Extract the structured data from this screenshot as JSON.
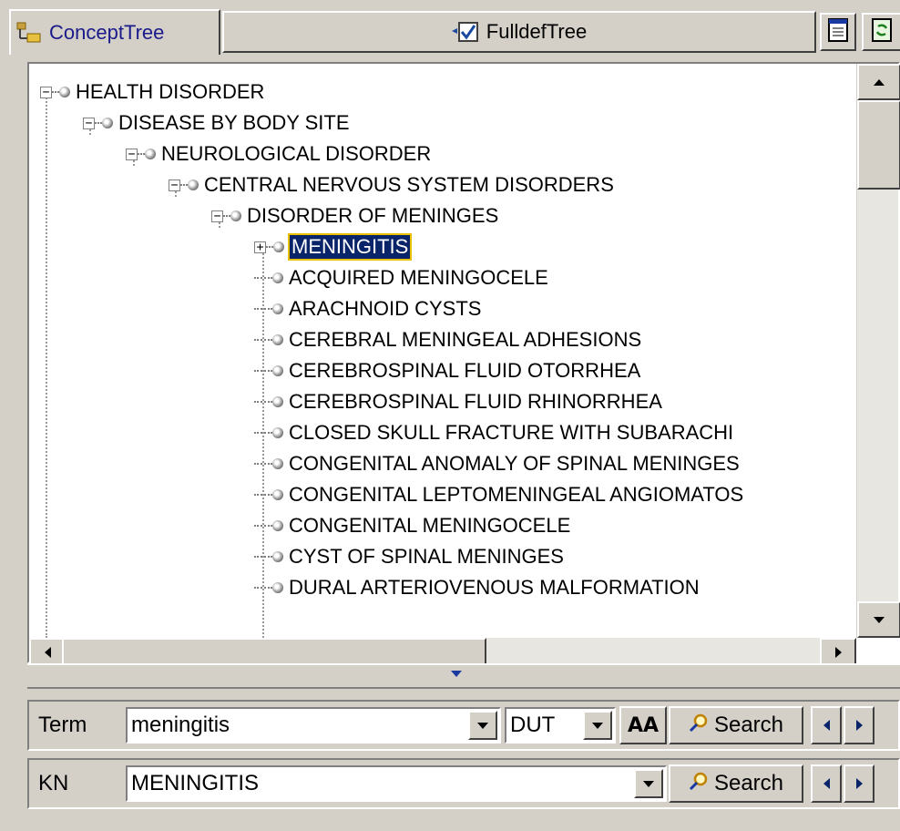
{
  "tabs": {
    "active_label": "ConceptTree",
    "inactive_label": "FulldefTree",
    "active_icon": "tree-folder-icon",
    "inactive_icon": "checkbox-icon"
  },
  "toolbar": {
    "icons": [
      "document-icon",
      "refresh-icon"
    ]
  },
  "tree": {
    "nodes": [
      {
        "label": "HEALTH DISORDER",
        "expander": "−"
      },
      {
        "label": "DISEASE BY BODY SITE",
        "expander": "−"
      },
      {
        "label": "NEUROLOGICAL DISORDER",
        "expander": "−"
      },
      {
        "label": "CENTRAL NERVOUS SYSTEM DISORDERS",
        "expander": "−"
      },
      {
        "label": "DISORDER OF MENINGES",
        "expander": "−"
      },
      {
        "label": "MENINGITIS",
        "expander": "+",
        "selected": true
      },
      {
        "label": "ACQUIRED MENINGOCELE"
      },
      {
        "label": "ARACHNOID CYSTS"
      },
      {
        "label": "CEREBRAL MENINGEAL ADHESIONS"
      },
      {
        "label": "CEREBROSPINAL FLUID OTORRHEA"
      },
      {
        "label": "CEREBROSPINAL FLUID RHINORRHEA"
      },
      {
        "label": "CLOSED SKULL FRACTURE WITH SUBARACHI"
      },
      {
        "label": "CONGENITAL ANOMALY OF SPINAL MENINGES"
      },
      {
        "label": "CONGENITAL LEPTOMENINGEAL ANGIOMATOS"
      },
      {
        "label": "CONGENITAL MENINGOCELE"
      },
      {
        "label": "CYST OF SPINAL MENINGES"
      },
      {
        "label": "DURAL ARTERIOVENOUS MALFORMATION"
      }
    ]
  },
  "term_row": {
    "label": "Term",
    "value": "meningitis",
    "language": "DUT",
    "case_button": "AA",
    "search_label": "Search"
  },
  "kn_row": {
    "label": "KN",
    "value": "MENINGITIS",
    "search_label": "Search"
  },
  "colors": {
    "selection": "#0a246a",
    "selection_outline": "#e8c000",
    "chrome": "#d4d0c8"
  }
}
